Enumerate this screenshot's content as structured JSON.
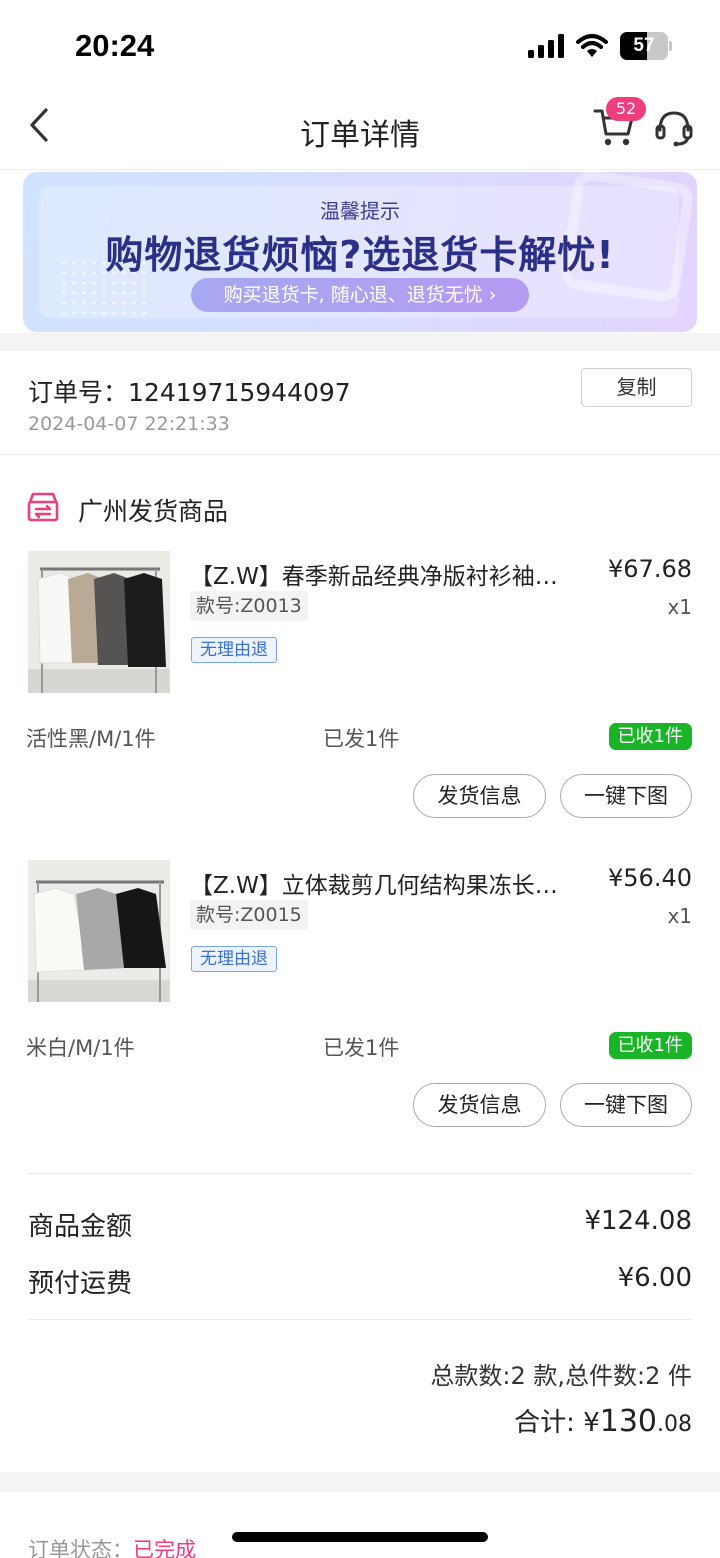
{
  "status_bar": {
    "time": "20:24",
    "battery": "57",
    "battery_level": 0.57
  },
  "nav": {
    "title": "订单详情",
    "cart_badge": "52"
  },
  "banner": {
    "subtitle": "温馨提示",
    "title": "购物退货烦恼?选退货卡解忧!",
    "pill": "购买退货卡, 随心退、退货无忧 ›"
  },
  "order": {
    "number_label": "订单号：",
    "number": "12419715944097",
    "datetime": "2024-04-07 22:21:33",
    "copy_label": "复制"
  },
  "shipment": {
    "label": "广州发货商品",
    "items": [
      {
        "name": "【Z.W】春季新品经典净版衬衫袖…",
        "price": "¥67.68",
        "style": "款号:Z0013",
        "qty": "x1",
        "tag": "无理由退",
        "spec": "活性黑/M/1件",
        "shipped": "已发1件",
        "received": "已收1件",
        "ship_info_label": "发货信息",
        "download_label": "一键下图"
      },
      {
        "name": "【Z.W】立体裁剪几何结构果冻长…",
        "price": "¥56.40",
        "style": "款号:Z0015",
        "qty": "x1",
        "tag": "无理由退",
        "spec": "米白/M/1件",
        "shipped": "已发1件",
        "received": "已收1件",
        "ship_info_label": "发货信息",
        "download_label": "一键下图"
      }
    ]
  },
  "summary": {
    "goods_label": "商品金额",
    "goods_value": "¥124.08",
    "freight_label": "预付运费",
    "freight_value": "¥6.00",
    "counts": "总款数:2 款,总件数:2 件",
    "total_label": "合计: ",
    "total_currency": "¥",
    "total_int": "130",
    "total_dec": ".08"
  },
  "order_status": {
    "label": "订单状态：",
    "value": "已完成"
  },
  "colors": {
    "accent": "#ee3e7e",
    "received_green": "#19b428",
    "tag_blue": "#3b6fd0"
  },
  "icons": [
    "back-icon",
    "cart-icon",
    "headset-icon",
    "shop-ship-icon",
    "signal-icon",
    "wifi-icon",
    "battery-icon"
  ]
}
